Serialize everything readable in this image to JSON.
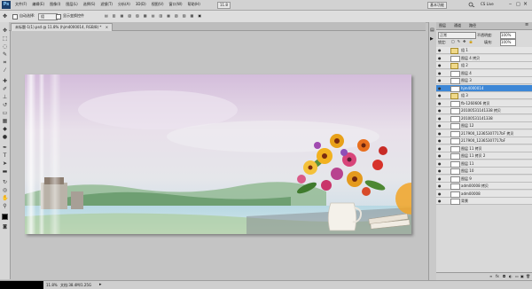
{
  "app": {
    "logo": "Ps"
  },
  "menu": [
    "文件(F)",
    "编辑(E)",
    "图像(I)",
    "图层(L)",
    "选择(S)",
    "滤镜(T)",
    "分析(A)",
    "3D(D)",
    "视图(V)",
    "窗口(W)",
    "帮助(H)"
  ],
  "menu_right": {
    "zoom": "11.8",
    "workspace": "基本功能",
    "cs_live": "CS Live"
  },
  "options": {
    "auto_select_label": "自动选择:",
    "auto_select_value": "组",
    "transform_label": "显示变换控件"
  },
  "document": {
    "tab_title": "未标题-1(1).psd @ 11.8% (hjm4000014, RGB/8) *",
    "zoom": "11.8%",
    "doc_info": "文档:38.4M/1.25G"
  },
  "layers_panel": {
    "blend_mode": "正常",
    "opacity_label": "不透明度:",
    "opacity": "100%",
    "lock_label": "锁定:",
    "fill_label": "填充:",
    "fill": "100%",
    "rows": [
      {
        "name": "组 1",
        "type": "group"
      },
      {
        "name": "图层 4 拷贝",
        "type": "layer"
      },
      {
        "name": "组 2",
        "type": "group"
      },
      {
        "name": "图层 4",
        "type": "layer"
      },
      {
        "name": "图层 3",
        "type": "layer"
      },
      {
        "name": "hjm4000014",
        "type": "layer",
        "selected": true
      },
      {
        "name": "组 3",
        "type": "group"
      },
      {
        "name": "fb-1260606 拷贝",
        "type": "layer"
      },
      {
        "name": "20100531141338 拷贝",
        "type": "layer"
      },
      {
        "name": "20100531141338",
        "type": "layer"
      },
      {
        "name": "图层 12",
        "type": "layer"
      },
      {
        "name": "217900_12365307717bF 拷贝",
        "type": "layer"
      },
      {
        "name": "217900_12365307717bF",
        "type": "layer"
      },
      {
        "name": "图层 11 拷贝",
        "type": "layer"
      },
      {
        "name": "图层 11 拷贝 2",
        "type": "layer"
      },
      {
        "name": "图层 11",
        "type": "layer"
      },
      {
        "name": "图层 10",
        "type": "layer"
      },
      {
        "name": "图层 9",
        "type": "layer"
      },
      {
        "name": "adm00008 拷贝",
        "type": "layer"
      },
      {
        "name": "adm00008",
        "type": "layer"
      },
      {
        "name": "背景",
        "type": "layer"
      }
    ]
  },
  "colors": {
    "selection": "#3d87d6",
    "menubar": "#d2d2d2",
    "workspace": "#c4c4c4"
  }
}
